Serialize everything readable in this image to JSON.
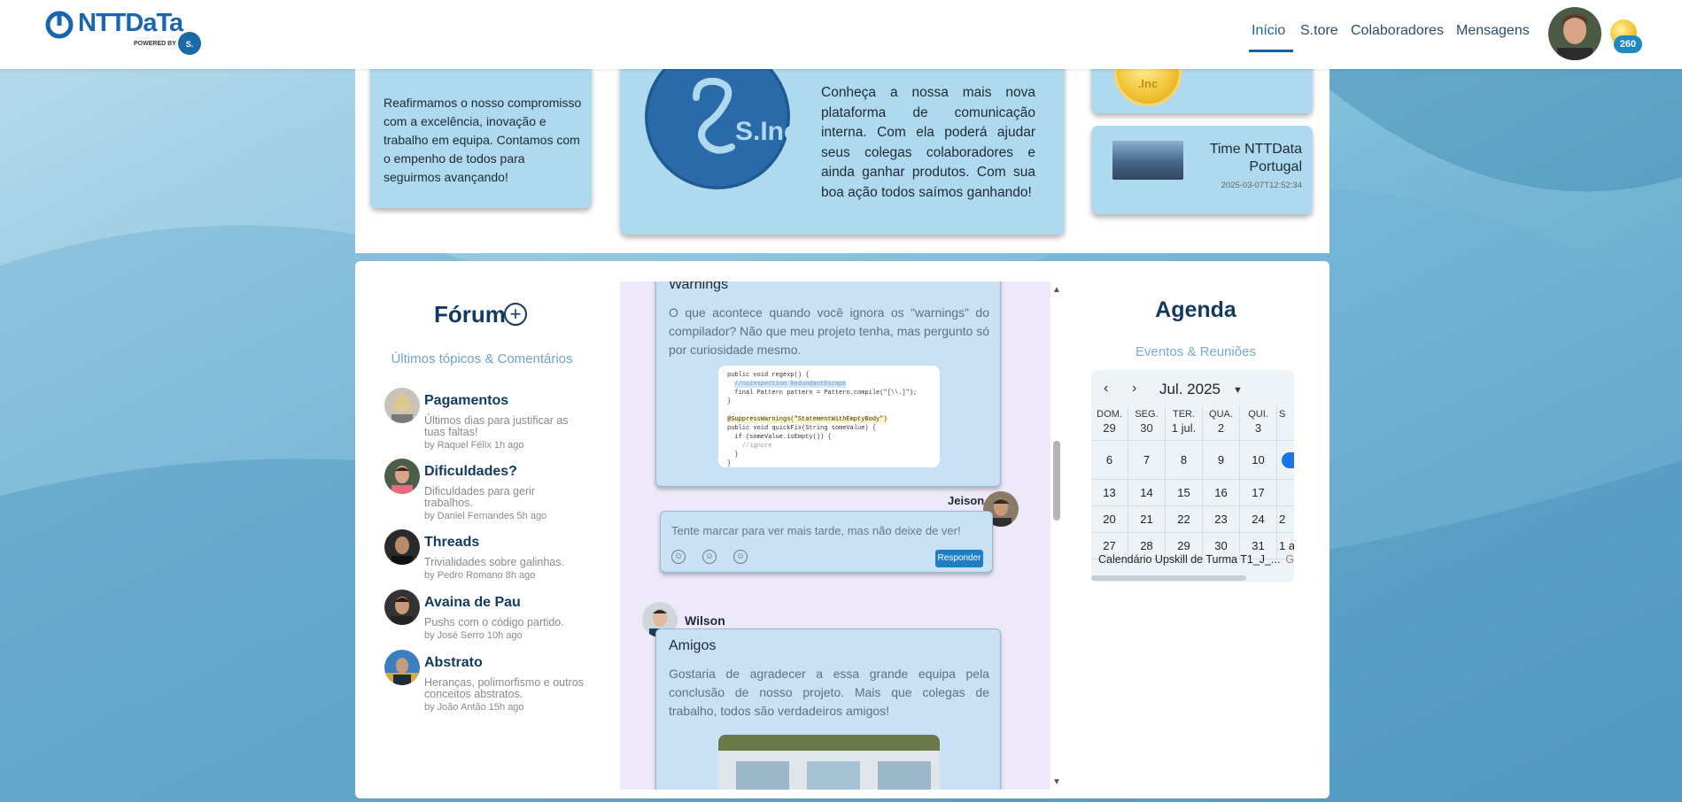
{
  "header": {
    "brand": "NTTDaTa",
    "powered_by": "POWERED BY",
    "nav": [
      "Início",
      "S.tore",
      "Colaboradores",
      "Mensagens"
    ],
    "points": "260"
  },
  "top_cards": {
    "card1_text": "Reafirmamos o nosso compromisso com a excelência, inovação e trabalho em equipa. Contamos com o empenho de todos para seguirmos avançando!",
    "card2_logo": "S.Inc",
    "card2_text": "Conheça a nossa mais nova plataforma de comunicação interna. Com ela poderá ajudar seus colegas colaboradores e ainda ganhar produtos. Com sua boa ação todos saímos ganhando!",
    "card3_coin_label": ".Inc",
    "card4_title": "Time NTTData Portugal",
    "card4_date": "2025-03-07T12:52:34"
  },
  "forum": {
    "title": "Fórum",
    "add_icon": "plus-circle-icon",
    "subtitle": "Últimos tópicos & Comentários",
    "topics": [
      {
        "title": "Pagamentos",
        "desc": "Últimos dias para justificar as tuas faltas!",
        "by": "by Raquel Félix 1h ago"
      },
      {
        "title": "Dificuldades?",
        "desc": "Dificuldades para gerir trabalhos.",
        "by": "by Daniel Fernandes 5h ago"
      },
      {
        "title": "Threads",
        "desc": "Trivialidades sobre galinhas.",
        "by": "by Pedro Romano 8h ago"
      },
      {
        "title": "Avaina de Pau",
        "desc": "Pushs com o código partido.",
        "by": "by José Serro 10h ago"
      },
      {
        "title": "Abstrato",
        "desc": "Heranças, polimorfismo e outros conceitos abstratos.",
        "by": "by João Antão 15h ago"
      }
    ]
  },
  "feed": {
    "post1_title": "Warnings",
    "post1_body": "O que acontece quando você ignora os \"warnings\" do compilador? Não que meu projeto tenha, mas pergunto só por curiosidade mesmo.",
    "reply_user": "Jeison",
    "reply_text": "Tente marcar para ver mais tarde, mas não deixe de ver!",
    "reply_button": "Responder",
    "post2_user": "Wilson",
    "post2_title": "Amigos",
    "post2_body": "Gostaria de agradecer a essa grande equipa pela conclusão de nosso projeto. Mais que colegas de trabalho, todos são verdadeiros amigos!"
  },
  "agenda": {
    "title": "Agenda",
    "subtitle": "Eventos & Reuniões",
    "month": "Jul. 2025",
    "weekdays": [
      "DOM.",
      "SEG.",
      "TER.",
      "QUA.",
      "QUI.",
      "S"
    ],
    "rows": [
      [
        "29",
        "30",
        "1 jul.",
        "2",
        "3",
        ""
      ],
      [
        "6",
        "7",
        "8",
        "9",
        "10",
        ""
      ],
      [
        "13",
        "14",
        "15",
        "16",
        "17",
        ""
      ],
      [
        "20",
        "21",
        "22",
        "23",
        "24",
        "2"
      ],
      [
        "27",
        "28",
        "29",
        "30",
        "31",
        "1 a"
      ]
    ],
    "event": "Calendário Upskill de Turma T1_J_...",
    "event_extra": "G"
  }
}
